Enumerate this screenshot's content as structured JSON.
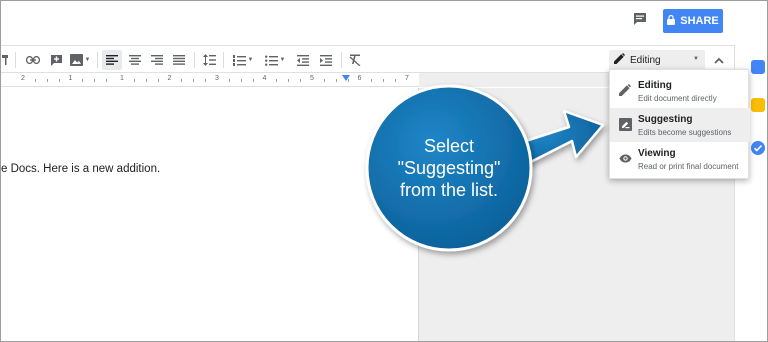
{
  "header": {
    "comments_icon": "comment-icon",
    "share_label": "SHARE",
    "share_icon": "lock-icon"
  },
  "toolbar": {
    "icons": [
      "insert-link-icon",
      "add-comment-icon",
      "insert-image-icon",
      "align-left-icon",
      "align-center-icon",
      "align-right-icon",
      "justify-icon",
      "line-spacing-icon",
      "numbered-list-icon",
      "bulleted-list-icon",
      "decrease-indent-icon",
      "increase-indent-icon",
      "clear-formatting-icon"
    ],
    "mode_label": "Editing",
    "mode_icon": "pencil-icon",
    "collapse_icon": "chevron-up-icon"
  },
  "ruler": {
    "numbers": [
      "2",
      "1",
      "1",
      "2",
      "3",
      "4",
      "5",
      "6",
      "7"
    ]
  },
  "document": {
    "text": "e Docs. Here is a new addition."
  },
  "mode_menu": {
    "items": [
      {
        "title": "Editing",
        "description": "Edit document directly",
        "icon": "pencil-icon"
      },
      {
        "title": "Suggesting",
        "description": "Edits become suggestions",
        "icon": "suggest-edit-icon"
      },
      {
        "title": "Viewing",
        "description": "Read or print final document",
        "icon": "eye-icon"
      }
    ],
    "highlighted": "Suggesting"
  },
  "callout": {
    "lines": [
      "Select",
      "\"Suggesting\"",
      "from the list."
    ],
    "color": "#0d6aa8"
  },
  "colors": {
    "accent": "#4285f4",
    "callout": "#0d6aa8",
    "keep": "#fbbc04"
  }
}
